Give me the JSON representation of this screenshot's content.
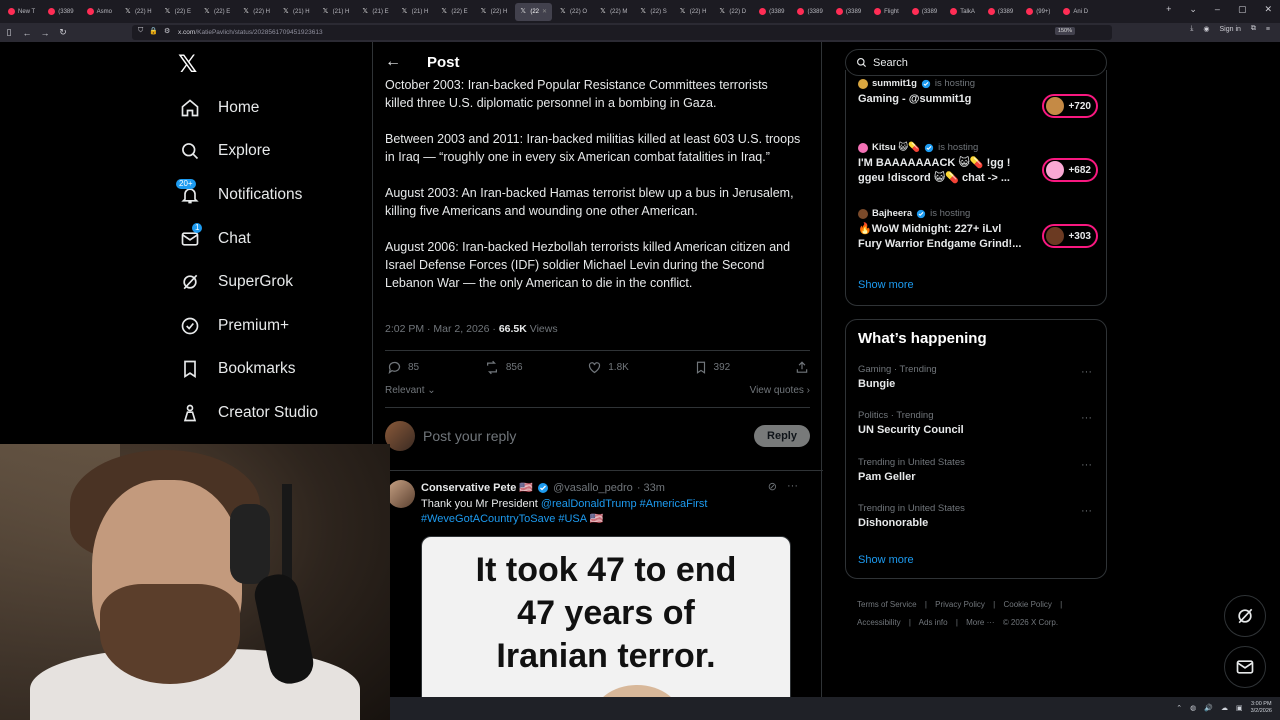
{
  "browser": {
    "tabs": [
      {
        "label": "New T",
        "active": false
      },
      {
        "label": "(3389",
        "active": false
      },
      {
        "label": "Asmo",
        "active": false
      },
      {
        "label": "(22) H",
        "active": false
      },
      {
        "label": "(22) E",
        "active": false
      },
      {
        "label": "(22) E",
        "active": false
      },
      {
        "label": "(22) H",
        "active": false
      },
      {
        "label": "(21) H",
        "active": false
      },
      {
        "label": "(21) H",
        "active": false
      },
      {
        "label": "(21) E",
        "active": false
      },
      {
        "label": "(21) H",
        "active": false
      },
      {
        "label": "(22) E",
        "active": false
      },
      {
        "label": "(22) H",
        "active": false
      },
      {
        "label": "(22",
        "active": true
      },
      {
        "label": "(22) O",
        "active": false
      },
      {
        "label": "(22) M",
        "active": false
      },
      {
        "label": "(22) S",
        "active": false
      },
      {
        "label": "(22) H",
        "active": false
      },
      {
        "label": "(22) D",
        "active": false
      },
      {
        "label": "(3389",
        "active": false
      },
      {
        "label": "(3389",
        "active": false
      },
      {
        "label": "(3389",
        "active": false
      },
      {
        "label": "Flight",
        "active": false
      },
      {
        "label": "(3389",
        "active": false
      },
      {
        "label": "TalkA",
        "active": false
      },
      {
        "label": "(3389",
        "active": false
      },
      {
        "label": "(99+)",
        "active": false
      },
      {
        "label": "Ani D",
        "active": false
      }
    ],
    "url_host": "x.com",
    "url_path": "/KatiePavlich/status/2028561709451923613",
    "zoom": "150%",
    "sign_in": "Sign in"
  },
  "nav": {
    "logo": "𝕏",
    "items": [
      {
        "label": "Home",
        "icon": "home-icon"
      },
      {
        "label": "Explore",
        "icon": "search-icon"
      },
      {
        "label": "Notifications",
        "icon": "bell-icon",
        "badge": "20+"
      },
      {
        "label": "Chat",
        "icon": "mail-icon",
        "badge": "1"
      },
      {
        "label": "SuperGrok",
        "icon": "grok-icon"
      },
      {
        "label": "Premium+",
        "icon": "verified-icon"
      },
      {
        "label": "Bookmarks",
        "icon": "bookmark-icon"
      },
      {
        "label": "Creator Studio",
        "icon": "creator-icon"
      }
    ]
  },
  "post": {
    "header": "Post",
    "cut_line": "October 2003: Iran-backed Popular Resistance Committees terrorists",
    "paragraphs": [
      "killed three U.S. diplomatic personnel in a bombing in Gaza.",
      "Between 2003 and 2011: Iran-backed militias killed at least 603 U.S. troops in Iraq — “roughly one in every six American combat fatalities in Iraq.”",
      "August 2003: An Iran-backed Hamas terrorist blew up a bus in Jerusalem, killing five Americans and wounding one other American.",
      "August 2006: Iran-backed Hezbollah terrorists killed American citizen and Israel Defense Forces (IDF) soldier Michael Levin during the Second Lebanon War — the only American to die in the conflict."
    ],
    "timestamp": "2:02 PM · Mar 2, 2026 · ",
    "views_count": "66.5K",
    "views_label": " Views",
    "replies": "85",
    "reposts": "856",
    "likes": "1.8K",
    "bookmarks": "392",
    "sort_label": "Relevant",
    "view_quotes": "View quotes"
  },
  "reply_box": {
    "placeholder": "Post your reply",
    "button": "Reply"
  },
  "reply_tweet": {
    "name": "Conservative Pete 🇺🇸",
    "handle": "@vasallo_pedro",
    "time": "· 33m",
    "text_prefix": "Thank you Mr President ",
    "mention": "@realDonaldTrump",
    "hashtag1": " #AmericaFirst",
    "hashtag_line2": "#WeveGotACountryToSave #USA",
    "flag": " 🇺🇸",
    "image_lines": [
      "It took 47 to end",
      "47 years of",
      "Iranian terror."
    ]
  },
  "right": {
    "search_placeholder": "Search",
    "live": [
      {
        "host": "summit1g",
        "status": "is hosting",
        "title": "Gaming - @summit1g",
        "count": "+720",
        "avatar_color": "#d9a640"
      },
      {
        "host": "Kitsu 😺💊",
        "status": "is hosting",
        "title": "I'M BAAAAAAACK 😺💊 !gg ! ggeu !discord 😺💊 chat -> ...",
        "count": "+682",
        "avatar_color": "#f472b6"
      },
      {
        "host": "Bajheera",
        "status": "is hosting",
        "title": "🔥WoW Midnight: 227+ iLvl Fury Warrior Endgame Grind!...",
        "count": "+303",
        "avatar_color": "#7a4a2a"
      }
    ],
    "show_more_1": "Show more",
    "happening_title": "What’s happening",
    "trends": [
      {
        "context": "Gaming · Trending",
        "name": "Bungie"
      },
      {
        "context": "Politics · Trending",
        "name": "UN Security Council"
      },
      {
        "context": "Trending in United States",
        "name": "Pam Geller"
      },
      {
        "context": "Trending in United States",
        "name": "Dishonorable"
      }
    ],
    "show_more_2": "Show more",
    "footer_line1": [
      "Terms of Service",
      "|",
      "Privacy Policy",
      "|",
      "Cookie Policy",
      "|"
    ],
    "footer_line2": [
      "Accessibility",
      "|",
      "Ads info",
      "|",
      "More ···",
      "© 2026 X Corp."
    ]
  },
  "taskbar": {
    "time": "3:00 PM",
    "date": "3/2/2026"
  },
  "colors": {
    "accent": "#1d9bf0",
    "live_ring": "#f91880",
    "muted": "#71767b",
    "border": "#2f3336"
  }
}
